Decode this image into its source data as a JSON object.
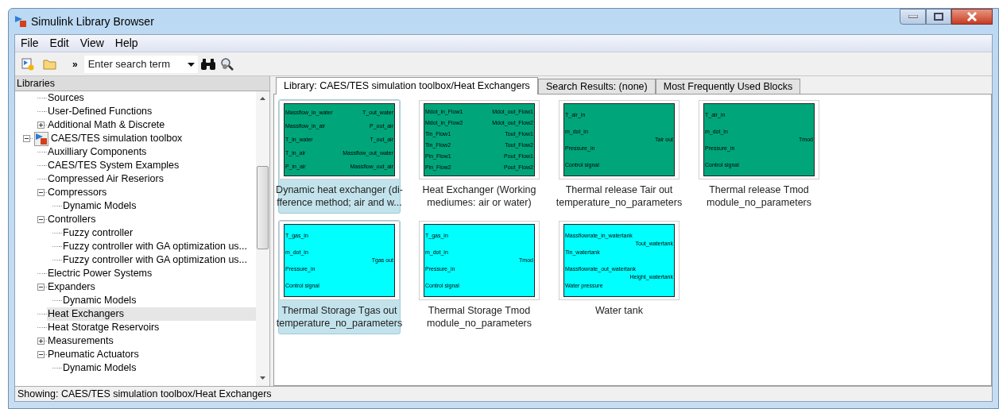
{
  "window": {
    "title": "Simulink Library Browser"
  },
  "menu": [
    "File",
    "Edit",
    "View",
    "Help"
  ],
  "toolbar": {
    "overflow": "»",
    "search": {
      "placeholder": "Enter search term"
    }
  },
  "libraries_pane": {
    "title": "Libraries",
    "tree": [
      {
        "label": "Sources",
        "kind": "node",
        "selected": false
      },
      {
        "label": "User-Defined Functions",
        "kind": "node",
        "selected": false
      },
      {
        "label": "Additional Math & Discrete",
        "kind": "node",
        "expanded": false,
        "selected": false
      },
      {
        "label": "CAES/TES simulation toolbox",
        "kind": "library",
        "expanded": true,
        "selected": false,
        "children": [
          {
            "label": "Auxilliary Components",
            "kind": "node",
            "selected": false
          },
          {
            "label": "CAES/TES System Examples",
            "kind": "node",
            "selected": false
          },
          {
            "label": "Compressed Air Reseriors",
            "kind": "node",
            "selected": false
          },
          {
            "label": "Compressors",
            "kind": "node",
            "expanded": true,
            "selected": false,
            "children": [
              {
                "label": "Dynamic Models",
                "kind": "node",
                "selected": false
              }
            ]
          },
          {
            "label": "Controllers",
            "kind": "node",
            "expanded": true,
            "selected": false,
            "children": [
              {
                "label": "Fuzzy controller",
                "kind": "node",
                "selected": false
              },
              {
                "label": "Fuzzy controller with GA optimization us...",
                "kind": "node",
                "selected": false
              },
              {
                "label": "Fuzzy controller with GA optimization us...",
                "kind": "node",
                "selected": false
              }
            ]
          },
          {
            "label": "Electric Power Systems",
            "kind": "node",
            "selected": false
          },
          {
            "label": "Expanders",
            "kind": "node",
            "expanded": true,
            "selected": false,
            "children": [
              {
                "label": "Dynamic Models",
                "kind": "node",
                "selected": false
              }
            ]
          },
          {
            "label": "Heat Exchangers",
            "kind": "node",
            "selected": true
          },
          {
            "label": "Heat Storatge Reservoirs",
            "kind": "node",
            "selected": false
          },
          {
            "label": "Measurements",
            "kind": "node",
            "expanded": false,
            "selected": false
          },
          {
            "label": "Pneumatic Actuators",
            "kind": "node",
            "expanded": true,
            "selected": false,
            "children": [
              {
                "label": "Dynamic Models",
                "kind": "node",
                "selected": false
              }
            ]
          }
        ]
      }
    ]
  },
  "tabs": [
    {
      "label": "Library: CAES/TES simulation toolbox/Heat Exchangers",
      "selected": true
    },
    {
      "label": "Search Results: (none)",
      "selected": false
    },
    {
      "label": "Most Frequently Used Blocks",
      "selected": false
    }
  ],
  "blocks": [
    {
      "caption": "Dynamic heat exchanger (di-\nfference method; air and w...",
      "selected": true,
      "color": "#00a67a",
      "inputs": [
        "Massflow_in_water",
        "Massflow_in_air",
        "T_in_water",
        "T_in_air",
        "P_in_air"
      ],
      "outputs": [
        "T_out_water",
        "P_out_air",
        "T_out_air",
        "Massflow_out_water",
        "Massflow_out_air"
      ]
    },
    {
      "caption": "Heat Exchanger (Working\nmediumes: air or water)",
      "selected": false,
      "color": "#00a67a",
      "inputs": [
        "Mdot_in_Flow1",
        "Mdot_in_Flow2",
        "Tin_Flow1",
        "Tin_Flow2",
        "Pin_Flow1",
        "Pin_Flow2"
      ],
      "outputs": [
        "Mdot_out_Flow1",
        "Mdot_out_Flow2",
        "Tout_Flow1",
        "Tout_Flow2",
        "Pout_Flow1",
        "Pout_Flow2"
      ]
    },
    {
      "caption": "Thermal release Tair out\ntemperature_no_parameters",
      "selected": false,
      "color": "#00a67a",
      "inputs": [
        "T_air_in",
        "m_dot_in",
        "Pressure_in",
        "Control signal"
      ],
      "outputs": [
        "Tair out"
      ]
    },
    {
      "caption": "Thermal release Tmod\nmodule_no_parameters",
      "selected": false,
      "color": "#00a67a",
      "inputs": [
        "T_air_in",
        "m_dot_in",
        "Pressure_in",
        "Control signal"
      ],
      "outputs": [
        "Tmod"
      ]
    },
    {
      "caption": "Thermal Storage Tgas out\ntemperature_no_parameters",
      "selected": true,
      "color": "#00ffff",
      "inputs": [
        "T_gas_in",
        "m_dot_in",
        "Pressure_in",
        "Control signal"
      ],
      "outputs": [
        "Tgas out"
      ]
    },
    {
      "caption": "Thermal Storage Tmod\nmodule_no_parameters",
      "selected": false,
      "color": "#00ffff",
      "inputs": [
        "T_gas_in",
        "m_dot_in",
        "Pressure_in",
        "Control signal"
      ],
      "outputs": [
        "Tmod"
      ]
    },
    {
      "caption": "Water tank",
      "selected": false,
      "color": "#00ffff",
      "inputs": [
        "Massflowrate_in_watertank",
        "Tin_watertank",
        "Massflowrate_out_watertank",
        "Water pressure"
      ],
      "outputs": [
        "Tout_watertank",
        "Height_watertank"
      ]
    }
  ],
  "status_bar": "Showing: CAES/TES simulation toolbox/Heat Exchangers"
}
